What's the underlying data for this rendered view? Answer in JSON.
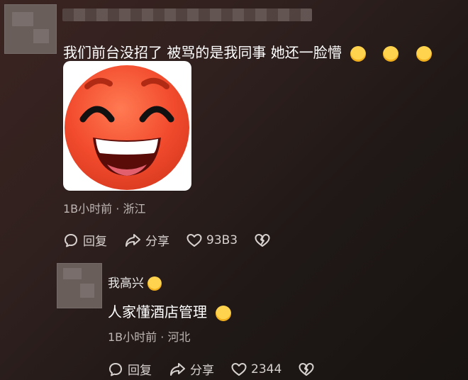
{
  "comment1": {
    "text": "我们前台没招了 被骂的是我同事 她还一脸懵",
    "emojis": [
      "sunglasses-cry-emoji",
      "sunglasses-cry-emoji",
      "sunglasses-emoji"
    ],
    "sticker": "laughing-face-sticker",
    "time": "1B小时前",
    "location": "浙江",
    "reply_label": "回复",
    "share_label": "分享",
    "like_count": "93B3"
  },
  "reply1": {
    "username": "我高兴",
    "text": "人家懂酒店管理",
    "time": "1B小时前",
    "location": "河北",
    "reply_label": "回复",
    "share_label": "分享",
    "like_count": "2344"
  }
}
